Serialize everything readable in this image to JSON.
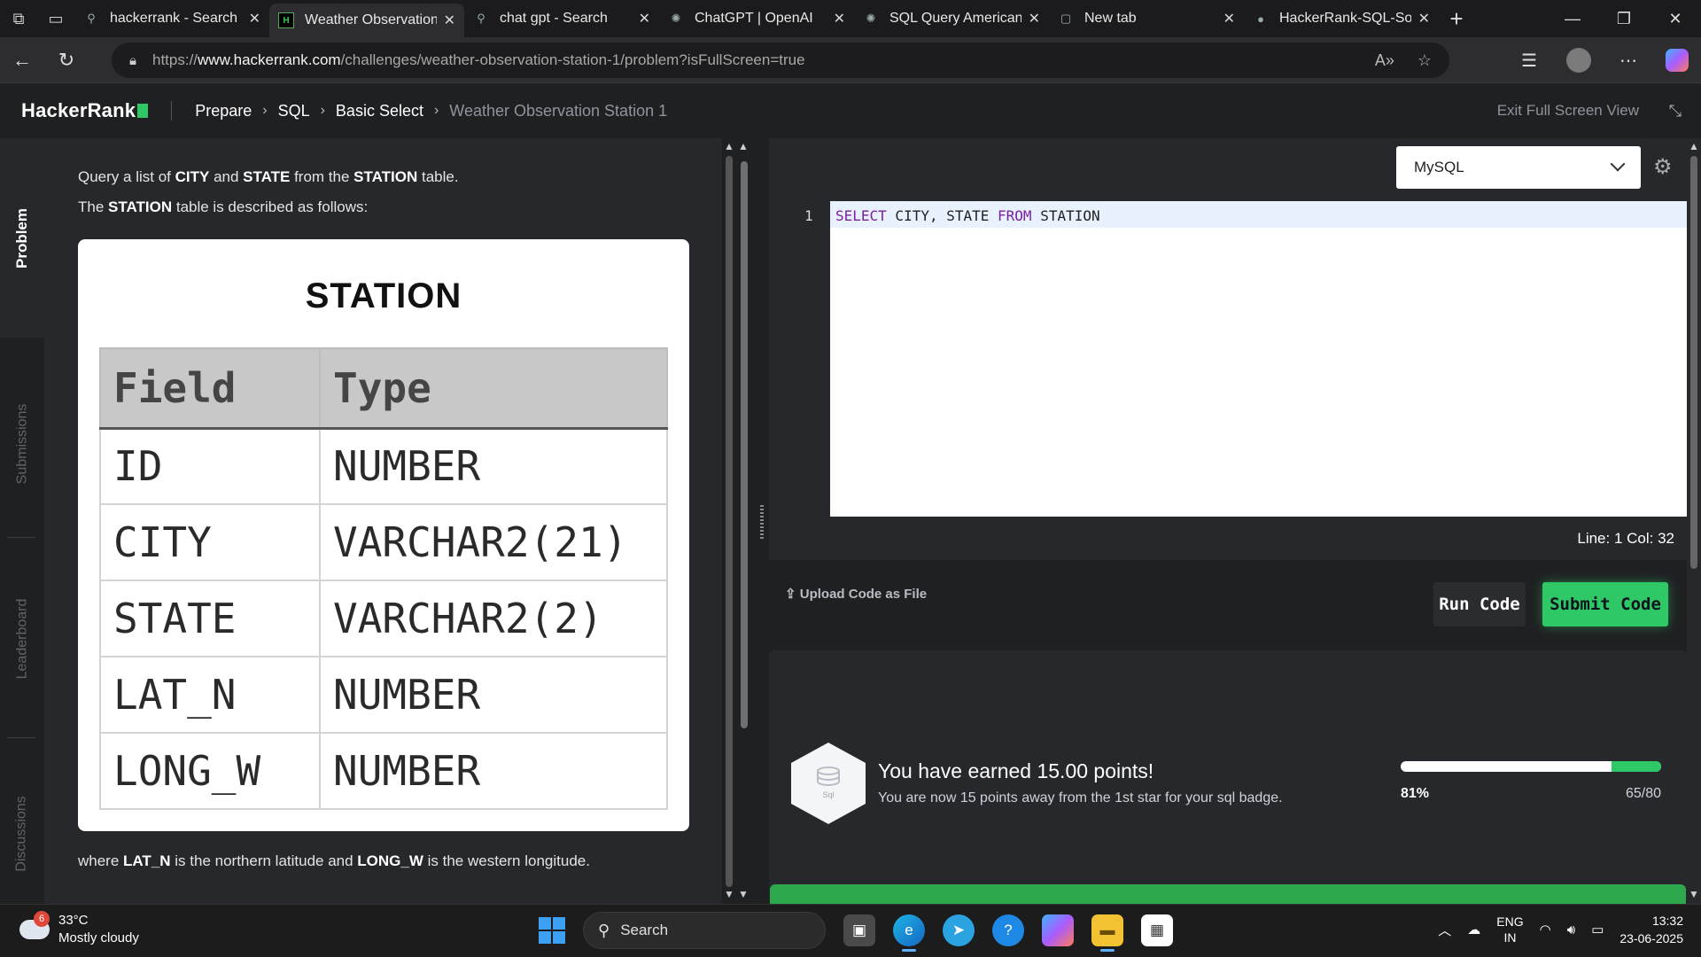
{
  "browser": {
    "tabs": [
      {
        "title": "hackerrank - Search",
        "icon": "search-icon"
      },
      {
        "title": "Weather Observation",
        "icon": "hackerrank-icon",
        "active": true
      },
      {
        "title": "chat gpt - Search",
        "icon": "search-icon"
      },
      {
        "title": "ChatGPT | OpenAI",
        "icon": "openai-icon"
      },
      {
        "title": "SQL Query American",
        "icon": "openai-icon"
      },
      {
        "title": "New tab",
        "icon": "newtab-icon"
      },
      {
        "title": "HackerRank-SQL-Solu",
        "icon": "github-icon"
      }
    ],
    "url_scheme": "https://",
    "url_host": "www.hackerrank.com",
    "url_path": "/challenges/weather-observation-station-1/problem?isFullScreen=true"
  },
  "header": {
    "logo": "HackerRank",
    "breadcrumbs": [
      "Prepare",
      "SQL",
      "Basic Select",
      "Weather Observation Station 1"
    ],
    "exit_fullscreen": "Exit Full Screen View"
  },
  "side_tabs": [
    "Problem",
    "Submissions",
    "Leaderboard",
    "Discussions"
  ],
  "problem": {
    "line1_pre": "Query a list of ",
    "line1_b1": "CITY",
    "line1_mid": " and ",
    "line1_b2": "STATE",
    "line1_mid2": " from the ",
    "line1_b3": "STATION",
    "line1_post": " table.",
    "line2_pre": "The ",
    "line2_b": "STATION",
    "line2_post": " table is described as follows:",
    "table_title": "STATION",
    "table_headers": [
      "Field",
      "Type"
    ],
    "table_rows": [
      [
        "ID",
        "NUMBER"
      ],
      [
        "CITY",
        "VARCHAR2(21)"
      ],
      [
        "STATE",
        "VARCHAR2(2)"
      ],
      [
        "LAT_N",
        "NUMBER"
      ],
      [
        "LONG_W",
        "NUMBER"
      ]
    ],
    "footer_pre": "where ",
    "footer_b1": "LAT_N",
    "footer_mid": " is the northern latitude and ",
    "footer_b2": "LONG_W",
    "footer_post": " is the western longitude."
  },
  "editor": {
    "language": "MySQL",
    "line_number": "1",
    "code_kw1": "SELECT",
    "code_mid": " CITY, STATE ",
    "code_kw2": "FROM",
    "code_end": " STATION",
    "status": "Line: 1 Col: 32",
    "upload_label": "Upload Code as File",
    "run_label": "Run Code",
    "submit_label": "Submit Code"
  },
  "result": {
    "badge_label": "Sql",
    "title": "You have earned 15.00 points!",
    "subtitle": "You are now 15 points away from the 1st star for your sql badge.",
    "progress_percent": "81%",
    "progress_fraction": 0.81,
    "points": "65/80"
  },
  "taskbar": {
    "weather_badge": "6",
    "temperature": "33°C",
    "condition": "Mostly cloudy",
    "search_label": "Search",
    "lang_top": "ENG",
    "lang_bottom": "IN",
    "time": "13:32",
    "date": "23-06-2025"
  },
  "colors": {
    "accent_green": "#2ec866",
    "panel_bg": "#26282b",
    "page_bg": "#1f2022"
  }
}
